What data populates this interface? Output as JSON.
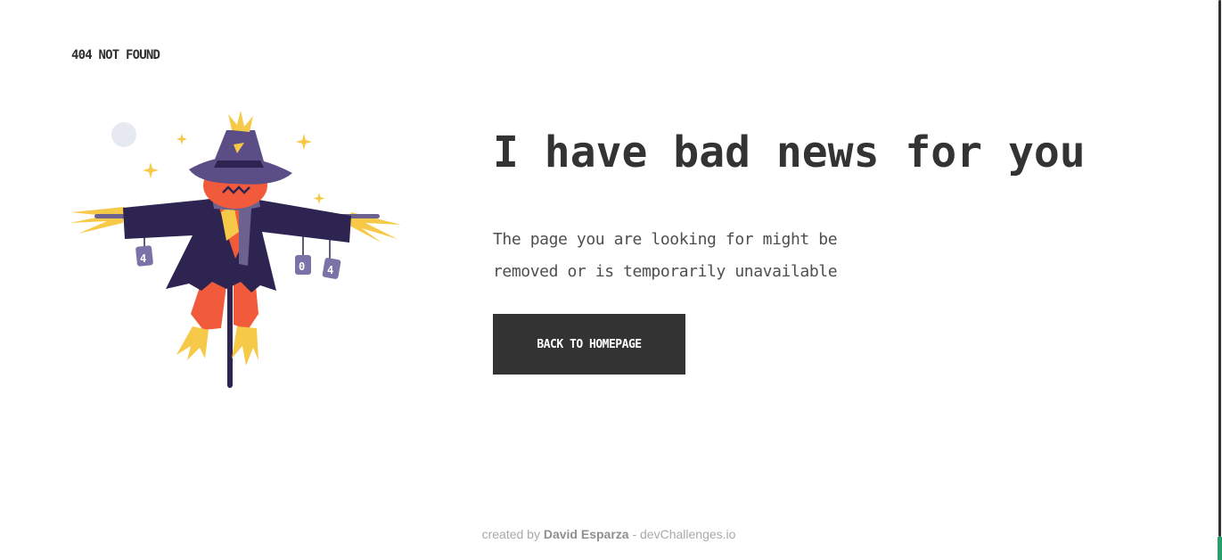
{
  "brand": {
    "label": "404 NOT FOUND"
  },
  "hero": {
    "headline": "I have bad news for you",
    "subtext_line1": "The page you are looking for might be",
    "subtext_line2": "removed or is temporarily unavailable",
    "cta_label": "BACK TO HOMEPAGE"
  },
  "illustration": {
    "can_labels": [
      "4",
      "0",
      "4"
    ],
    "colors": {
      "hat": "#5b4e86",
      "coat": "#2d2452",
      "face": "#f25a3c",
      "straw": "#f7c948",
      "scarf": "#6c628f",
      "cans": "#7b72a8",
      "moon": "#e6e8f2"
    }
  },
  "footer": {
    "prefix": "created by",
    "author": "David Esparza",
    "separator": "-",
    "site": "devChallenges.io"
  },
  "colors": {
    "text_dark": "#333333",
    "text_muted": "#4f4f4f",
    "button_bg": "#333333",
    "button_text": "#ffffff"
  }
}
